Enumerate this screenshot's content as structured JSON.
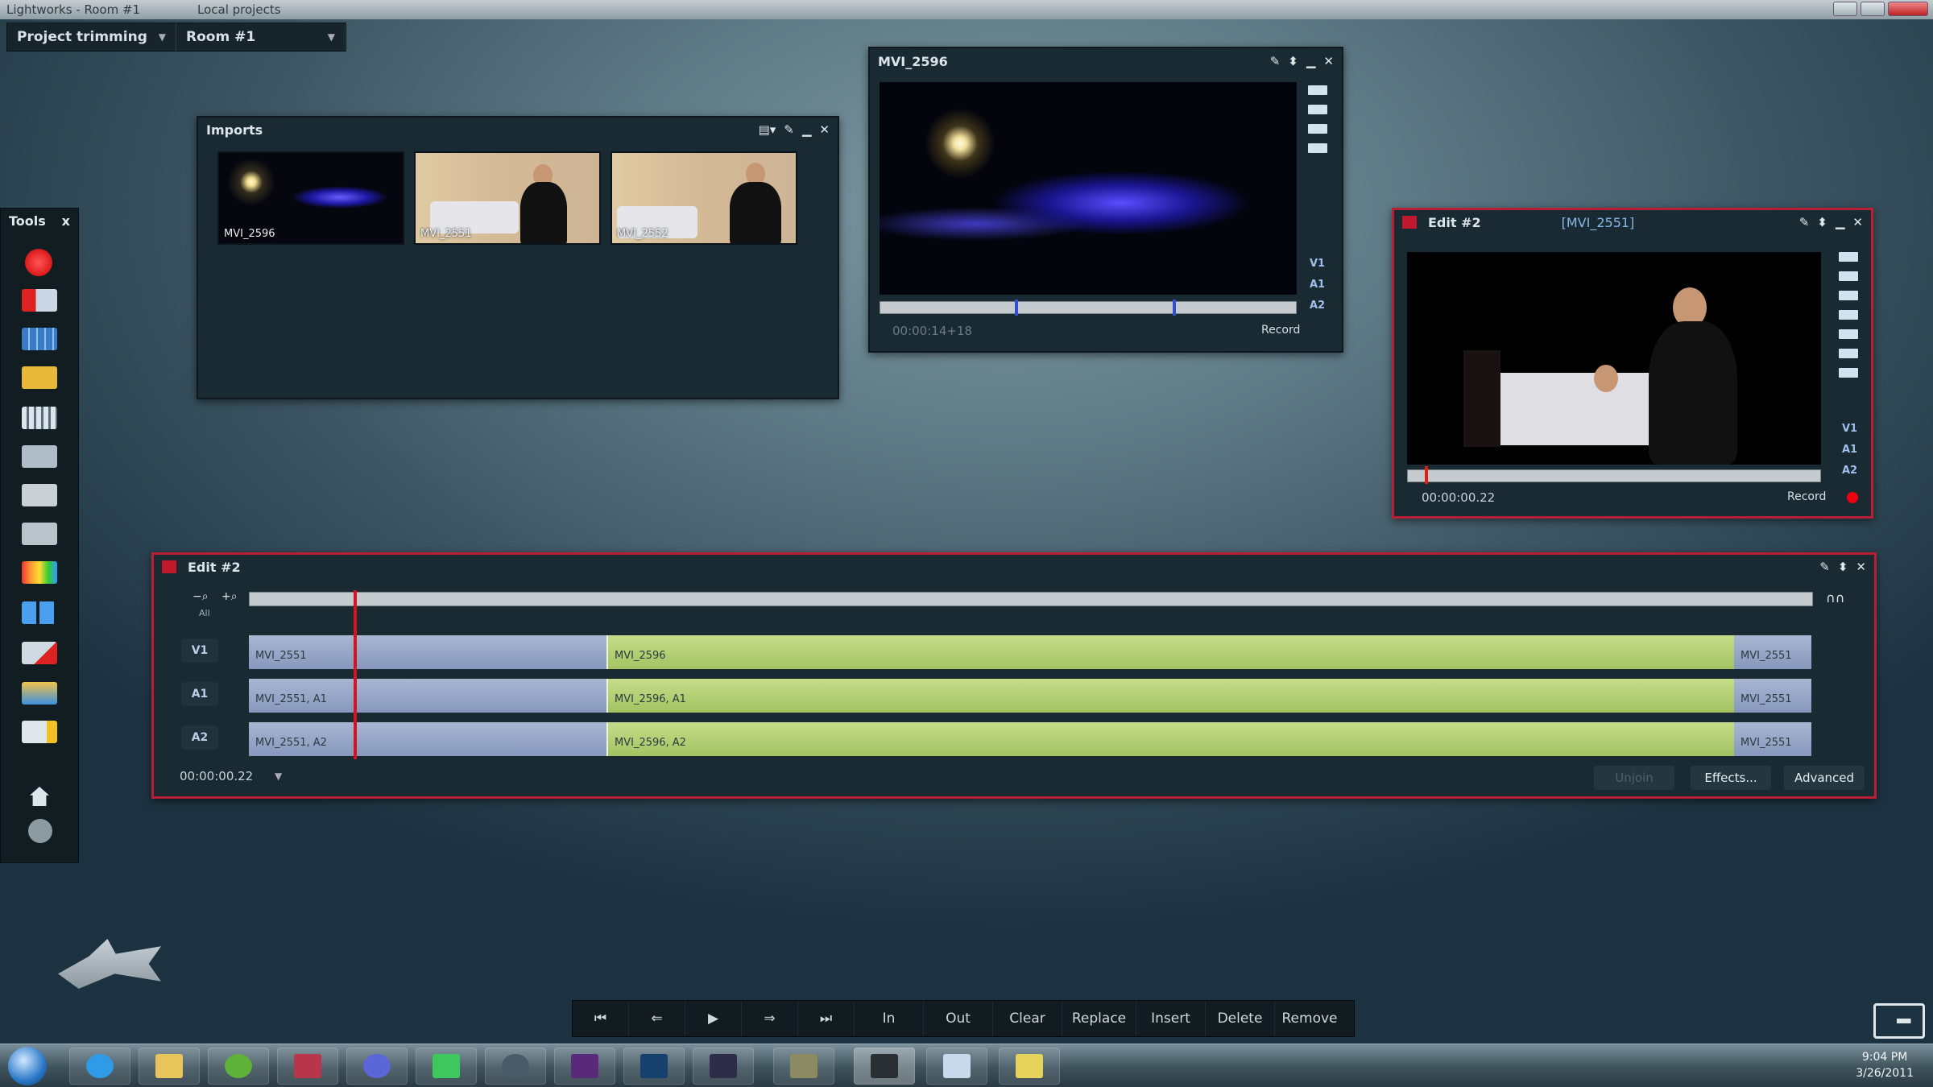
{
  "window": {
    "app_title": "Lightworks - Room #1",
    "project_crumb": "Local projects"
  },
  "header": {
    "project_select": "Project trimming",
    "room_select": "Room #1"
  },
  "tools": {
    "title": "Tools",
    "close": "x"
  },
  "imports": {
    "title": "Imports",
    "clips": [
      "MVI_2596",
      "MVI_2551",
      "MVI_2552"
    ]
  },
  "source_viewer": {
    "title": "MVI_2596",
    "timecode": "00:00:14+18",
    "mode": "Record",
    "tracks": [
      "V1",
      "A1",
      "A2"
    ]
  },
  "record_viewer": {
    "title": "Edit #2",
    "subtitle": "[MVI_2551]",
    "timecode": "00:00:00.22",
    "mode": "Record",
    "tracks": [
      "V1",
      "A1",
      "A2"
    ]
  },
  "timeline": {
    "title": "Edit #2",
    "all_label": "All",
    "timecode": "00:00:00.22",
    "tracks": [
      {
        "label": "V1",
        "clips": [
          "MVI_2551",
          "MVI_2596",
          "MVI_2551"
        ]
      },
      {
        "label": "A1",
        "clips": [
          "MVI_2551, A1",
          "MVI_2596, A1",
          "MVI_2551"
        ]
      },
      {
        "label": "A2",
        "clips": [
          "MVI_2551, A2",
          "MVI_2596, A2",
          "MVI_2551"
        ]
      }
    ],
    "buttons": {
      "unjoin": "Unjoin",
      "effects": "Effects...",
      "advanced": "Advanced"
    }
  },
  "transport": {
    "buttons": [
      "In",
      "Out",
      "Clear",
      "Replace",
      "Insert",
      "Delete",
      "Remove"
    ]
  },
  "taskbar": {
    "time": "9:04 PM",
    "date": "3/26/2011"
  },
  "colors": {
    "accent_red": "#b81e34",
    "clip_blue": "#8f9fc5",
    "clip_green": "#b6d174",
    "panel_bg": "#1a2a33"
  }
}
